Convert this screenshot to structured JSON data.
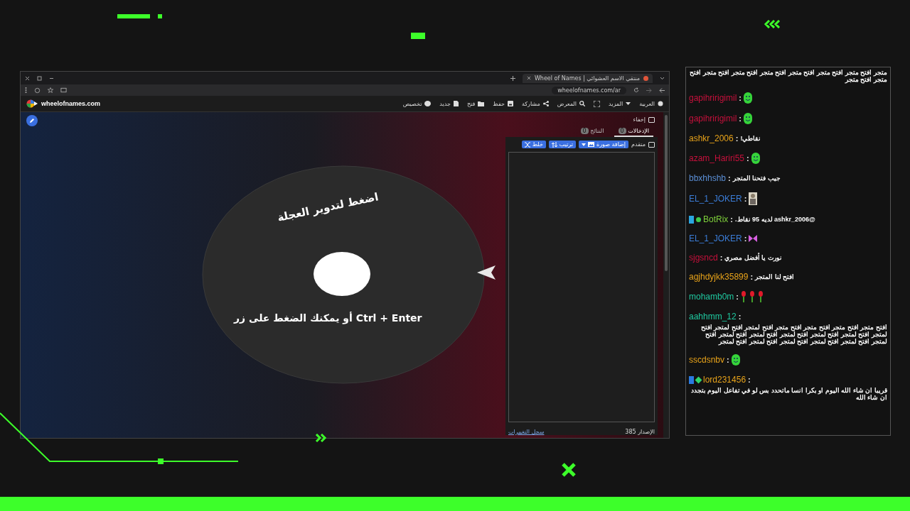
{
  "browser": {
    "tab_title": "Wheel of Names | منتقي الاسم العشوائي",
    "url": "wheelofnames.com/ar"
  },
  "site": {
    "logo_text": "wheelofnames.com",
    "nav": [
      "العربية",
      "المزيد",
      "المعرض",
      "مشاركة",
      "حفظ",
      "فتح",
      "جديد",
      "تخصيص"
    ]
  },
  "wheel": {
    "lines": [
      "اضغط لتدوير العجلة",
      "أو يمكنك الضغط على زر Ctrl + Enter"
    ]
  },
  "panel": {
    "hide": {
      "label": "إخفاء",
      "checked": false
    },
    "tabs": [
      {
        "label": "الإدخالات",
        "count": "0",
        "selected": true
      },
      {
        "label": "النتائج",
        "count": "0",
        "selected": false
      }
    ],
    "advanced": {
      "label": "متقدم",
      "checked": false
    },
    "buttons": [
      "إضافة صورة",
      "ترتيب",
      "خلط"
    ],
    "version": "الإصدار 385",
    "changelog": "سجل التغييرات"
  },
  "chat": {
    "top_text": "متجر افتح متجر افتح متجر افتح متجر افتح متجر افتح متجر افتح متجر افتح متجر افتح متجر",
    "messages": [
      {
        "user": "gapihririgimil",
        "color": "#c8103c",
        "colon": ":",
        "kind": "face"
      },
      {
        "user": "gapihririgimil",
        "color": "#c8103c",
        "colon": ":",
        "kind": "face"
      },
      {
        "user": "ashkr_2006",
        "color": "#e8a31a",
        "colon": ":",
        "kind": "text",
        "text": "نقاطي!"
      },
      {
        "user": "azam_Hariri55",
        "color": "#c8103c",
        "colon": ":",
        "kind": "face"
      },
      {
        "user": "bbxhhshb",
        "color": "#5b8fd6",
        "colon": ":",
        "kind": "text",
        "text": "جيب فتحنا المتجر"
      },
      {
        "user": "EL_1_JOKER",
        "color": "#3b7dd8",
        "colon": ":",
        "kind": "sticker"
      },
      {
        "user": "BotRix",
        "color": "#7fd13b",
        "colon": ":",
        "kind": "bot",
        "text": "@ashkr_2006 لديه 95 نقاط."
      },
      {
        "user": "EL_1_JOKER",
        "color": "#3b7dd8",
        "colon": ":",
        "kind": "bow"
      },
      {
        "user": "sjgsncd",
        "color": "#c8103c",
        "colon": ":",
        "kind": "text",
        "text": "نورت يا أفضل مصري"
      },
      {
        "user": "agjhdyjkk35899",
        "color": "#e8a31a",
        "colon": ":",
        "kind": "text",
        "text": "افتح لنا المتجر"
      },
      {
        "user": "mohamb0m",
        "color": "#1fc9a0",
        "colon": ":",
        "kind": "roses"
      },
      {
        "user": "aahhmm_12",
        "color": "#1fc9a0",
        "colon": ":",
        "kind": "text",
        "text": "افتح متجر افتح متجر افتح متجر افتح متجر افتح لمتجر افتح لمتجر افتح لمتجر افتح لمتجر افتح لمتجر افتح لمتجر افتح لمتجر افتح لمتجر افتح لمتجر افتح لمتجر افتح لمتجر افتح لمتجر افتح لمتجر افتح لمتجر"
      },
      {
        "user": "sscdsnbv",
        "color": "#e8a31a",
        "colon": ":",
        "kind": "face"
      },
      {
        "user": "lord231456",
        "color": "#e8a31a",
        "colon": ":",
        "kind": "subscriber",
        "text": "قريبا ان شاء الله اليوم او بكرا انسا ماتحدد بس لو في تفاعل اليوم بتجدد ان شاء الله"
      }
    ]
  }
}
